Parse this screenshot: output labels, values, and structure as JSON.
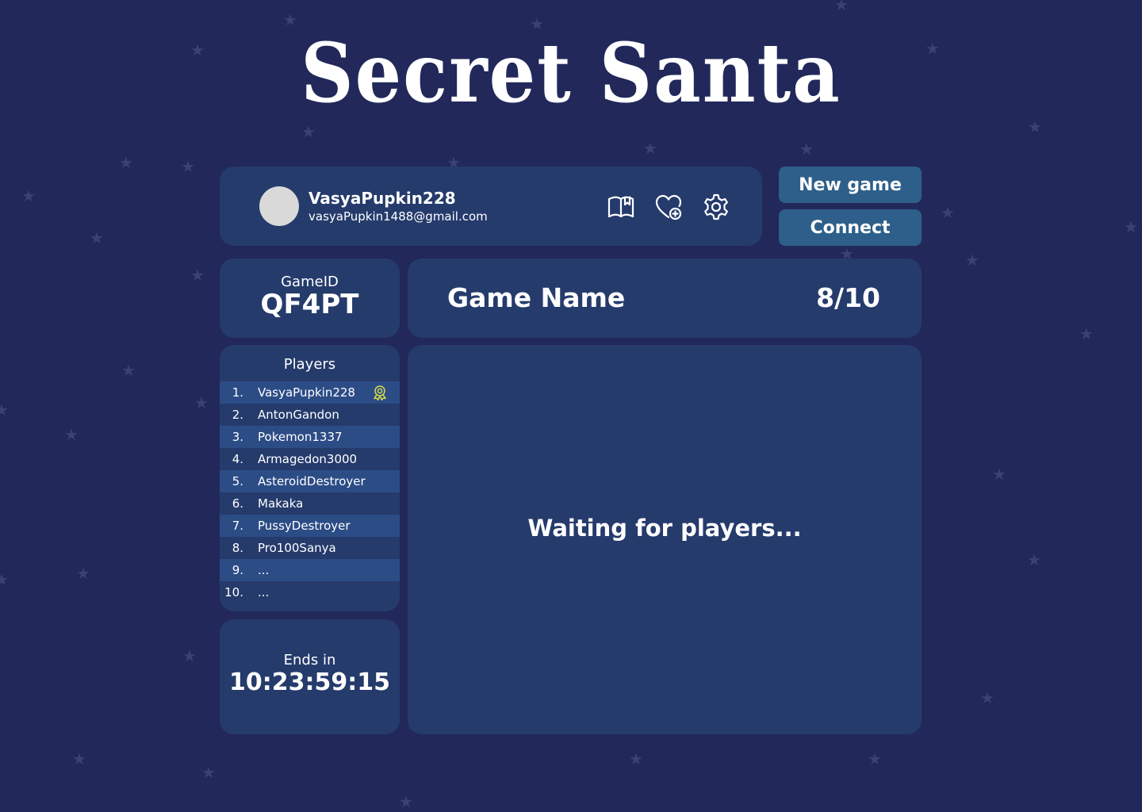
{
  "app": {
    "title": "Secret Santa"
  },
  "profile": {
    "username": "VasyaPupkin228",
    "email": "vasyaPupkin1488@gmail.com",
    "icons": [
      "book-icon",
      "heart-add-icon",
      "gear-icon"
    ]
  },
  "actions": {
    "new_game_label": "New game",
    "connect_label": "Connect"
  },
  "game": {
    "id_label": "GameID",
    "id": "QF4PT",
    "name": "Game Name",
    "player_count": "8/10"
  },
  "players": {
    "title": "Players",
    "items": [
      {
        "num": "1.",
        "name": "VasyaPupkin228",
        "owner": true
      },
      {
        "num": "2.",
        "name": "AntonGandon"
      },
      {
        "num": "3.",
        "name": "Pokemon1337"
      },
      {
        "num": "4.",
        "name": "Armagedon3000"
      },
      {
        "num": "5.",
        "name": "AsteroidDestroyer"
      },
      {
        "num": "6.",
        "name": "Makaka"
      },
      {
        "num": "7.",
        "name": "PussyDestroyer"
      },
      {
        "num": "8.",
        "name": "Pro100Sanya"
      },
      {
        "num": "9.",
        "name": "..."
      },
      {
        "num": "10.",
        "name": "..."
      }
    ]
  },
  "timer": {
    "label": "Ends in",
    "value": "10:23:59:15"
  },
  "status": {
    "message": "Waiting for players..."
  },
  "colors": {
    "background": "#22285a",
    "panel": "#253b6c",
    "row_highlight": "#2c4c86",
    "button": "#2d5f8a",
    "owner_icon": "#d6d94a"
  }
}
